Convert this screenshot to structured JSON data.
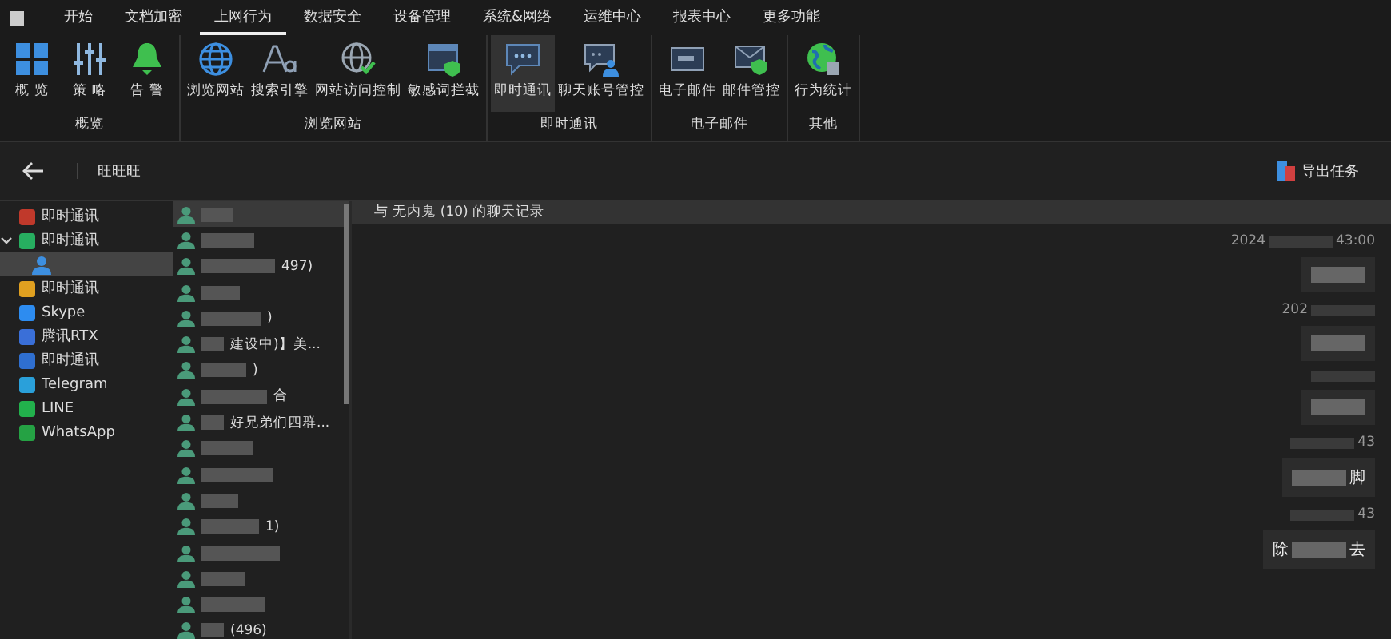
{
  "menu_tabs": [
    {
      "label": "开始",
      "selected": false
    },
    {
      "label": "文档加密",
      "selected": false
    },
    {
      "label": "上网行为",
      "selected": true
    },
    {
      "label": "数据安全",
      "selected": false
    },
    {
      "label": "设备管理",
      "selected": false
    },
    {
      "label": "系统&网络",
      "selected": false
    },
    {
      "label": "运维中心",
      "selected": false
    },
    {
      "label": "报表中心",
      "selected": false
    },
    {
      "label": "更多功能",
      "selected": false
    }
  ],
  "ribbon_groups": [
    {
      "title": "概览",
      "buttons": [
        {
          "label": "概 览",
          "kind": "tiles",
          "selected": false
        },
        {
          "label": "策 略",
          "kind": "sliders",
          "selected": false
        },
        {
          "label": "告 警",
          "kind": "bell",
          "selected": false
        }
      ]
    },
    {
      "title": "浏览网站",
      "buttons": [
        {
          "label": "浏览网站",
          "kind": "globe",
          "selected": false
        },
        {
          "label": "搜索引擎",
          "kind": "font",
          "selected": false
        },
        {
          "label": "网站访问控制",
          "kind": "globecheck",
          "selected": false
        },
        {
          "label": "敏感词拦截",
          "kind": "windowshield",
          "selected": false
        }
      ]
    },
    {
      "title": "即时通讯",
      "buttons": [
        {
          "label": "即时通讯",
          "kind": "chat",
          "selected": true
        },
        {
          "label": "聊天账号管控",
          "kind": "chatuser",
          "selected": false
        }
      ]
    },
    {
      "title": "电子邮件",
      "buttons": [
        {
          "label": "电子邮件",
          "kind": "mail",
          "selected": false
        },
        {
          "label": "邮件管控",
          "kind": "mailshield",
          "selected": false
        }
      ]
    },
    {
      "title": "其他",
      "buttons": [
        {
          "label": "行为统计",
          "kind": "earthchart",
          "selected": false
        }
      ]
    }
  ],
  "toolbar": {
    "title": "旺旺旺",
    "export_button": "导出任务"
  },
  "sidebar": {
    "items": [
      {
        "label": "即时通讯",
        "color": "#c0392b",
        "expanded": false
      },
      {
        "label": "即时通讯",
        "color": "#27ae60",
        "expanded": true,
        "children": [
          {
            "selected": true
          }
        ]
      },
      {
        "label": "即时通讯",
        "color": "#e0a020",
        "expanded": false
      },
      {
        "label": "Skype",
        "color": "#2d8cf0",
        "expanded": false
      },
      {
        "label": "腾讯RTX",
        "color": "#3a6fd8",
        "expanded": false
      },
      {
        "label": "即时通讯",
        "color": "#2f6fd0",
        "expanded": false
      },
      {
        "label": "Telegram",
        "color": "#2aa0da",
        "expanded": false
      },
      {
        "label": "LINE",
        "color": "#22b14c",
        "expanded": false
      },
      {
        "label": "WhatsApp",
        "color": "#25a244",
        "expanded": false
      }
    ]
  },
  "contacts": [
    {
      "selected": true
    },
    {
      "selected": false
    },
    {
      "suffix": "497)",
      "selected": false
    },
    {
      "selected": false
    },
    {
      "suffix": ")",
      "selected": false
    },
    {
      "suffix": "建设中)】美...",
      "selected": false
    },
    {
      "suffix": ")",
      "selected": false
    },
    {
      "suffix": "合",
      "selected": false
    },
    {
      "suffix": "好兄弟们四群...",
      "selected": false
    },
    {
      "selected": false
    },
    {
      "selected": false
    },
    {
      "selected": false
    },
    {
      "suffix": "1)",
      "selected": false
    },
    {
      "selected": false
    },
    {
      "selected": false
    },
    {
      "selected": false
    },
    {
      "suffix": "(496)",
      "selected": false
    }
  ],
  "chat": {
    "header": "与 无内鬼 (10) 的聊天记录",
    "messages": [
      {
        "kind": "text",
        "time_start": "2024",
        "time_end": "43:00"
      },
      {
        "kind": "text",
        "time_start": "202"
      },
      {
        "kind": "text"
      },
      {
        "kind": "text",
        "time_end": "43",
        "text_end": "脚"
      },
      {
        "kind": "text",
        "time_end": "43",
        "text_start": "除",
        "text_end": "去"
      }
    ]
  }
}
